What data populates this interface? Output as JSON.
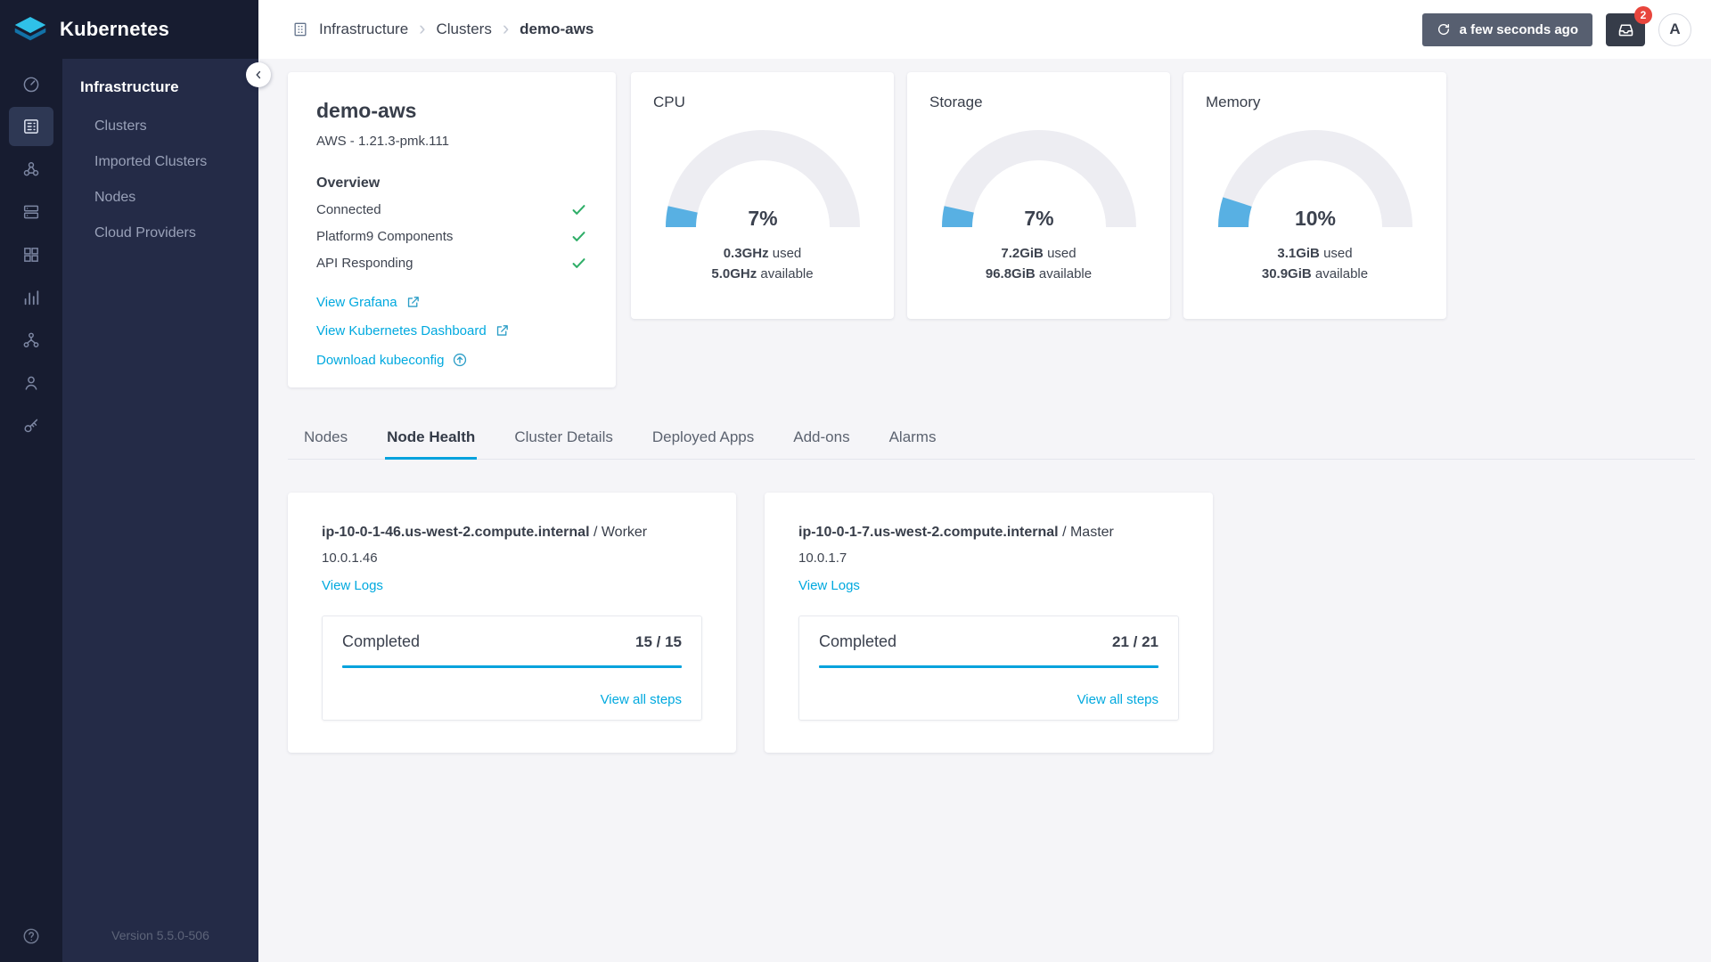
{
  "app_title": "Kubernetes",
  "sidebar": {
    "section_title": "Infrastructure",
    "items": [
      {
        "label": "Clusters"
      },
      {
        "label": "Imported Clusters"
      },
      {
        "label": "Nodes"
      },
      {
        "label": "Cloud Providers"
      }
    ],
    "version": "Version 5.5.0-506"
  },
  "topbar": {
    "breadcrumb": [
      {
        "label": "Infrastructure"
      },
      {
        "label": "Clusters"
      },
      {
        "label": "demo-aws"
      }
    ],
    "separator": "›",
    "refresh_label": "a few seconds ago",
    "notification_count": "2",
    "avatar_initial": "A"
  },
  "overview_card": {
    "title": "demo-aws",
    "subtitle": "AWS - 1.21.3-pmk.111",
    "section_title": "Overview",
    "checks": [
      {
        "label": "Connected"
      },
      {
        "label": "Platform9 Components"
      },
      {
        "label": "API Responding"
      }
    ],
    "links": [
      {
        "label": "View Grafana"
      },
      {
        "label": "View Kubernetes Dashboard"
      },
      {
        "label": "Download kubeconfig"
      }
    ]
  },
  "gauges": [
    {
      "title": "CPU",
      "percent": 7,
      "percent_label": "7%",
      "used": "0.3GHz",
      "used_word": " used",
      "available": "5.0GHz",
      "available_word": " available"
    },
    {
      "title": "Storage",
      "percent": 7,
      "percent_label": "7%",
      "used": "7.2GiB",
      "used_word": " used",
      "available": "96.8GiB",
      "available_word": " available"
    },
    {
      "title": "Memory",
      "percent": 10,
      "percent_label": "10%",
      "used": "3.1GiB",
      "used_word": " used",
      "available": "30.9GiB",
      "available_word": " available"
    }
  ],
  "tabs": [
    {
      "label": "Nodes"
    },
    {
      "label": "Node Health"
    },
    {
      "label": "Cluster Details"
    },
    {
      "label": "Deployed Apps"
    },
    {
      "label": "Add-ons"
    },
    {
      "label": "Alarms"
    }
  ],
  "node_health": [
    {
      "hostname": "ip-10-0-1-46.us-west-2.compute.internal",
      "role": " / Worker",
      "ip": "10.0.1.46",
      "view_logs": "View Logs",
      "status": "Completed",
      "progress": "15 / 15",
      "view_all": "View all steps"
    },
    {
      "hostname": "ip-10-0-1-7.us-west-2.compute.internal",
      "role": " / Master",
      "ip": "10.0.1.7",
      "view_logs": "View Logs",
      "status": "Completed",
      "progress": "21 / 21",
      "view_all": "View all steps"
    }
  ],
  "colors": {
    "accent_link": "#00a9df",
    "progress_bar": "#04a2dd",
    "gauge_fill": "#58b0e3",
    "success_check": "#2fae68",
    "badge_red": "#e8453c",
    "sidebar_bg": "#171c30",
    "sidebar_panel_bg": "#242b47"
  }
}
